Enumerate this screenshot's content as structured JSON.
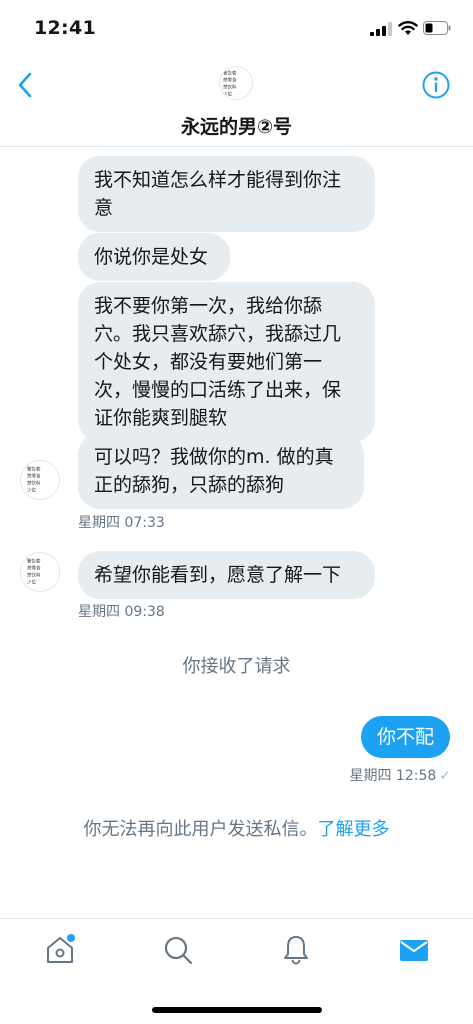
{
  "status_bar": {
    "time": "12:41"
  },
  "header": {
    "title": "永远的男②号",
    "avatar_lines": [
      "警告套",
      "禁零食",
      "禁饮料",
      "少位",
      "卡"
    ]
  },
  "conversation": {
    "received_group_1": [
      "我不知道怎么样才能得到你注意",
      "你说你是处女",
      "我不要你第一次，我给你舔穴。我只喜欢舔穴，我舔过几个处女，都没有要她们第一次，慢慢的口活练了出来，保证你能爽到腿软",
      "可以吗？我做你的m. 做的真正的舔狗，只舔的舔狗"
    ],
    "timestamp_1": "星期四 07:33",
    "received_group_2": [
      "希望你能看到，愿意了解一下"
    ],
    "timestamp_2": "星期四 09:38",
    "system_message": "你接收了请求",
    "sent_message": "你不配",
    "sent_timestamp": "星期四 12:58",
    "sent_status": "✓",
    "notice_text": "你无法再向此用户发送私信。",
    "notice_link": "了解更多"
  },
  "tab_bar": {
    "active": "messages",
    "accent": "#1da1f2"
  },
  "colors": {
    "bubble_received": "#e6ecf0",
    "bubble_sent": "#1da1f2",
    "secondary_text": "#657786"
  }
}
